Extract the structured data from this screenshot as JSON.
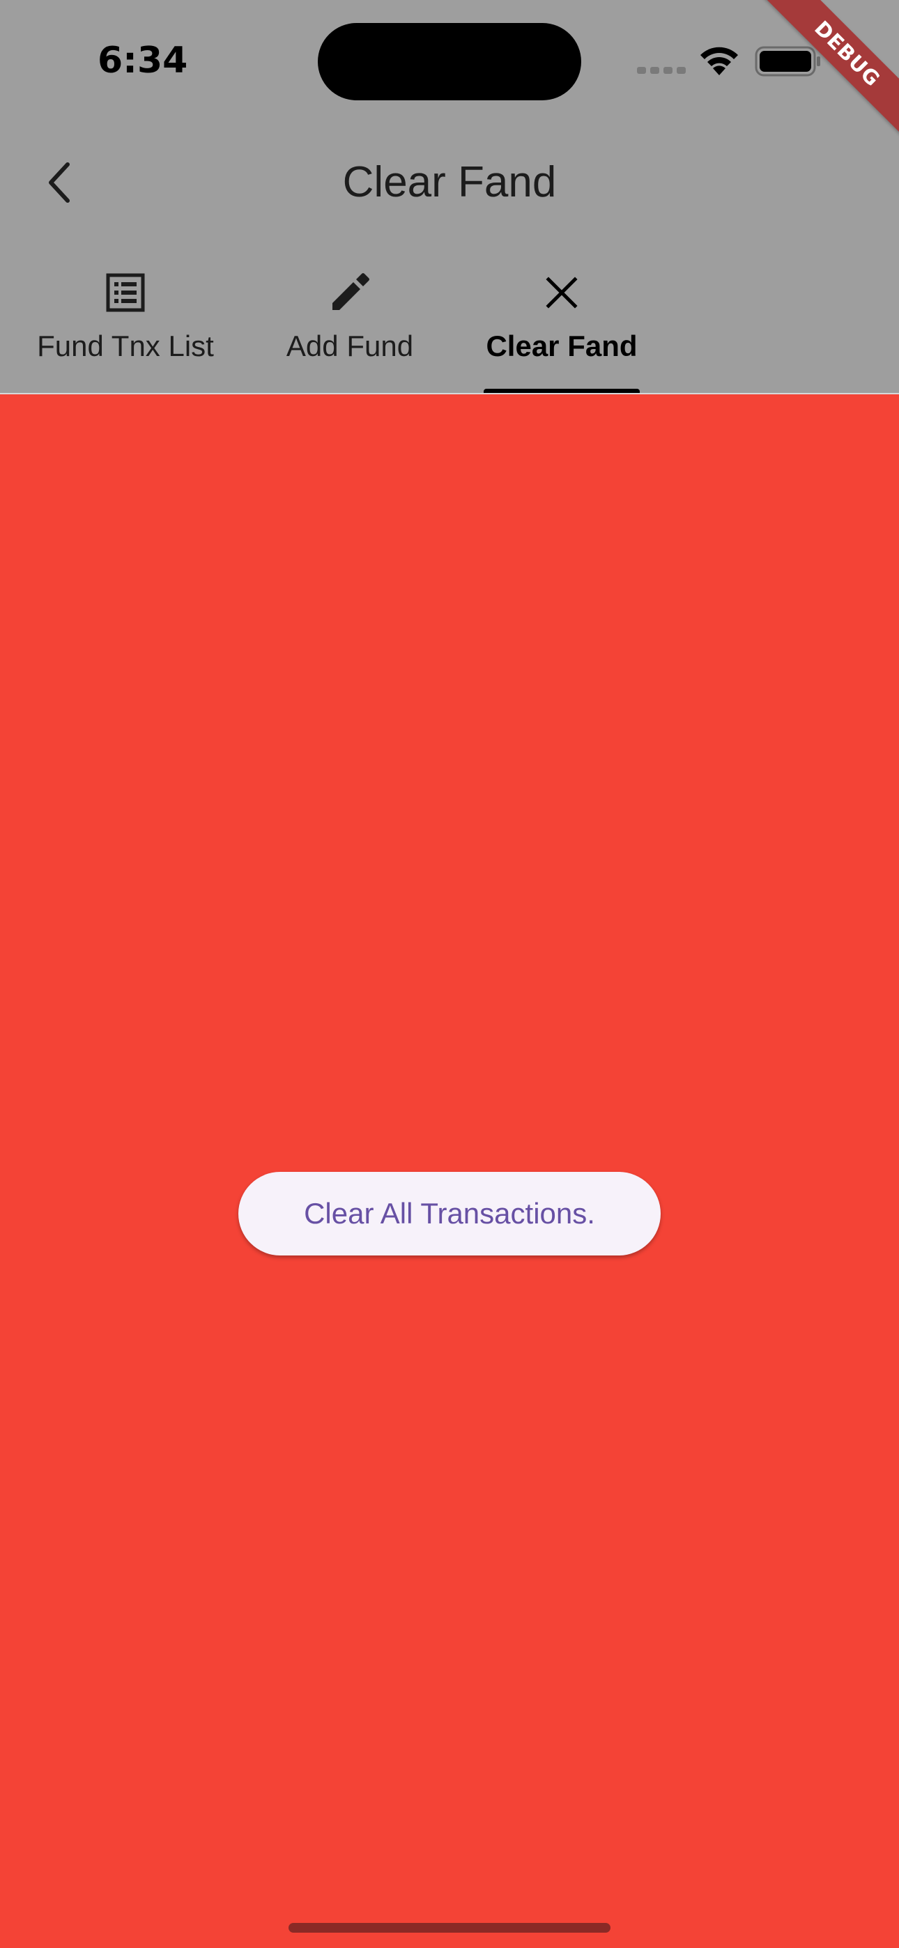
{
  "status_bar": {
    "time": "6:34"
  },
  "debug_banner": {
    "label": "DEBUG"
  },
  "app_bar": {
    "title": "Clear Fand",
    "back_icon": "chevron-left-icon"
  },
  "tabs": [
    {
      "label": "Fund Tnx List",
      "icon": "list-icon",
      "selected": false
    },
    {
      "label": "Add Fund",
      "icon": "pencil-icon",
      "selected": false
    },
    {
      "label": "Clear Fand",
      "icon": "close-icon",
      "selected": true
    }
  ],
  "main": {
    "clear_button_label": "Clear All Transactions."
  },
  "colors": {
    "app_bar_background": "#9e9e9e",
    "body_background": "#f44336",
    "button_background": "#f7f2fa",
    "button_text": "#6750a4",
    "debug_ribbon": "#a53a3a"
  }
}
